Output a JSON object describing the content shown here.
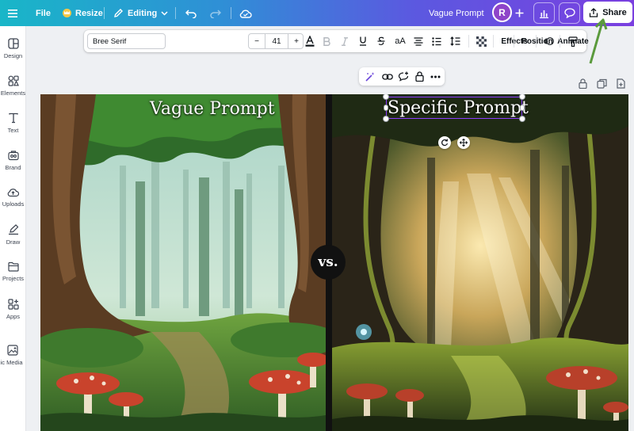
{
  "topbar": {
    "menu_icon": "hamburger-icon",
    "file_label": "File",
    "resize_label": "Resize",
    "editing_label": "Editing",
    "doc_title": "Vague Prompt",
    "avatar_initial": "R",
    "share_label": "Share",
    "gradient": [
      "#19b6c8",
      "#5b59e0",
      "#7a3fe0"
    ]
  },
  "sidebar": {
    "items": [
      {
        "label": "Design",
        "icon": "design-icon"
      },
      {
        "label": "Elements",
        "icon": "elements-icon"
      },
      {
        "label": "Text",
        "icon": "text-icon"
      },
      {
        "label": "Brand",
        "icon": "brand-icon"
      },
      {
        "label": "Uploads",
        "icon": "uploads-icon"
      },
      {
        "label": "Draw",
        "icon": "draw-icon"
      },
      {
        "label": "Projects",
        "icon": "projects-icon"
      },
      {
        "label": "Apps",
        "icon": "apps-icon"
      },
      {
        "label": "Magic Media",
        "icon": "magic-media-icon"
      }
    ]
  },
  "text_toolbar": {
    "font_family": "Bree Serif",
    "font_size": "41",
    "decrease": "−",
    "increase": "+",
    "effects_label": "Effects",
    "animate_label": "Animate",
    "position_label": "Position",
    "case_label": "aA"
  },
  "canvas": {
    "left_title": "Vague Prompt",
    "right_title": "Specific Prompt",
    "vs_label": "vs.",
    "accent": "#8b3dff"
  }
}
